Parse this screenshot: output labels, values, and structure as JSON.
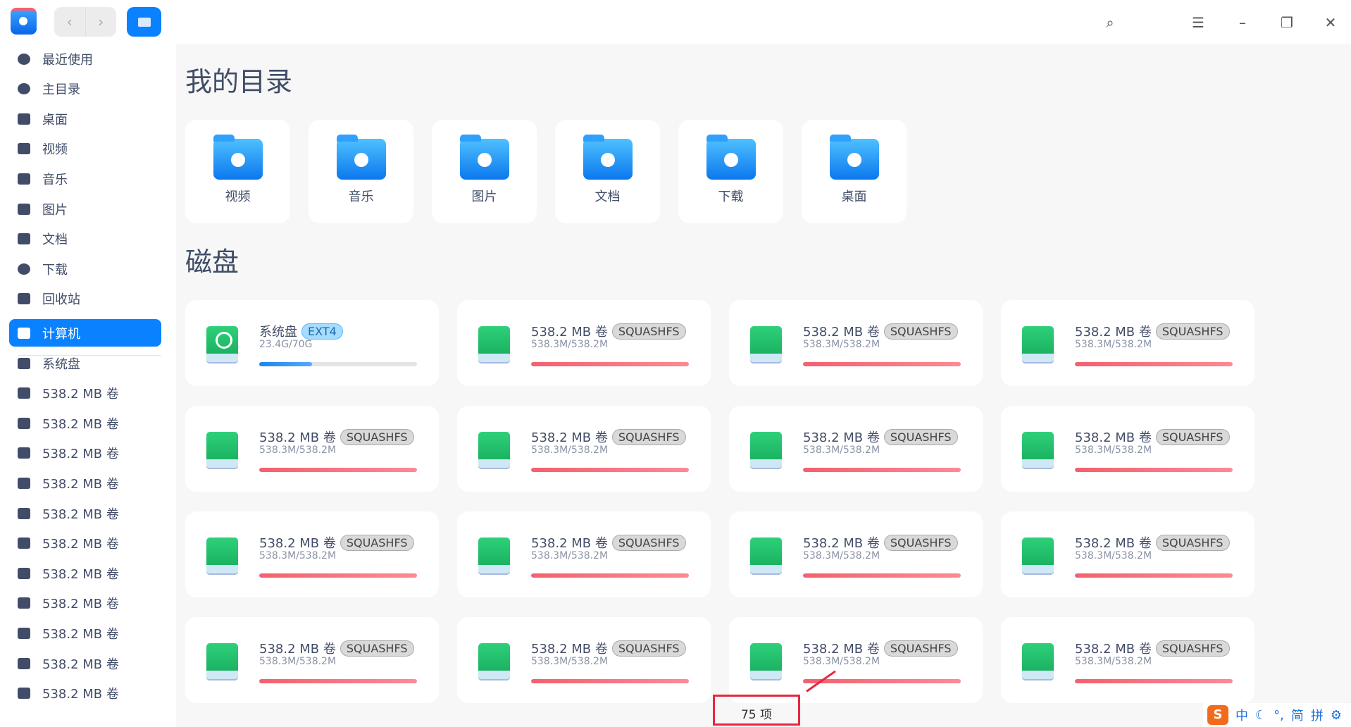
{
  "header": {
    "icons": [
      "app-logo",
      "back-icon",
      "forward-icon",
      "computer-view-icon",
      "search-icon",
      "menu-icon",
      "minimize-icon",
      "maximize-icon",
      "close-icon"
    ]
  },
  "sidebar": {
    "items": [
      {
        "label": "最近使用",
        "icon": "clock-icon"
      },
      {
        "label": "主目录",
        "icon": "home-icon"
      },
      {
        "label": "桌面",
        "icon": "desktop-icon"
      },
      {
        "label": "视频",
        "icon": "video-icon"
      },
      {
        "label": "音乐",
        "icon": "music-icon"
      },
      {
        "label": "图片",
        "icon": "picture-icon"
      },
      {
        "label": "文档",
        "icon": "document-icon"
      },
      {
        "label": "下载",
        "icon": "download-icon"
      },
      {
        "label": "回收站",
        "icon": "trash-icon"
      },
      {
        "label": "计算机",
        "icon": "computer-icon",
        "selected": true
      },
      {
        "label": "系统盘",
        "icon": "system-disk-icon"
      },
      {
        "label": "538.2 MB 卷",
        "icon": "disk-icon"
      },
      {
        "label": "538.2 MB 卷",
        "icon": "disk-icon"
      },
      {
        "label": "538.2 MB 卷",
        "icon": "disk-icon"
      },
      {
        "label": "538.2 MB 卷",
        "icon": "disk-icon"
      },
      {
        "label": "538.2 MB 卷",
        "icon": "disk-icon"
      },
      {
        "label": "538.2 MB 卷",
        "icon": "disk-icon"
      },
      {
        "label": "538.2 MB 卷",
        "icon": "disk-icon"
      },
      {
        "label": "538.2 MB 卷",
        "icon": "disk-icon"
      },
      {
        "label": "538.2 MB 卷",
        "icon": "disk-icon"
      },
      {
        "label": "538.2 MB 卷",
        "icon": "disk-icon"
      },
      {
        "label": "538.2 MB 卷",
        "icon": "disk-icon"
      }
    ]
  },
  "main": {
    "dirs_title": "我的目录",
    "folders": [
      {
        "label": "视频"
      },
      {
        "label": "音乐"
      },
      {
        "label": "图片"
      },
      {
        "label": "文档"
      },
      {
        "label": "下载"
      },
      {
        "label": "桌面"
      }
    ],
    "disks_title": "磁盘",
    "disks": [
      {
        "name": "系统盘",
        "fs": "EXT4",
        "usage": "23.4G/70G",
        "used": 0.334,
        "system": true
      },
      {
        "name": "538.2 MB 卷",
        "fs": "SQUASHFS",
        "usage": "538.3M/538.2M",
        "used": 1
      },
      {
        "name": "538.2 MB 卷",
        "fs": "SQUASHFS",
        "usage": "538.3M/538.2M",
        "used": 1
      },
      {
        "name": "538.2 MB 卷",
        "fs": "SQUASHFS",
        "usage": "538.3M/538.2M",
        "used": 1
      },
      {
        "name": "538.2 MB 卷",
        "fs": "SQUASHFS",
        "usage": "538.3M/538.2M",
        "used": 1
      },
      {
        "name": "538.2 MB 卷",
        "fs": "SQUASHFS",
        "usage": "538.3M/538.2M",
        "used": 1
      },
      {
        "name": "538.2 MB 卷",
        "fs": "SQUASHFS",
        "usage": "538.3M/538.2M",
        "used": 1
      },
      {
        "name": "538.2 MB 卷",
        "fs": "SQUASHFS",
        "usage": "538.3M/538.2M",
        "used": 1
      },
      {
        "name": "538.2 MB 卷",
        "fs": "SQUASHFS",
        "usage": "538.3M/538.2M",
        "used": 1
      },
      {
        "name": "538.2 MB 卷",
        "fs": "SQUASHFS",
        "usage": "538.3M/538.2M",
        "used": 1
      },
      {
        "name": "538.2 MB 卷",
        "fs": "SQUASHFS",
        "usage": "538.3M/538.2M",
        "used": 1
      },
      {
        "name": "538.2 MB 卷",
        "fs": "SQUASHFS",
        "usage": "538.3M/538.2M",
        "used": 1
      },
      {
        "name": "538.2 MB 卷",
        "fs": "SQUASHFS",
        "usage": "538.3M/538.2M",
        "used": 1
      },
      {
        "name": "538.2 MB 卷",
        "fs": "SQUASHFS",
        "usage": "538.3M/538.2M",
        "used": 1
      },
      {
        "name": "538.2 MB 卷",
        "fs": "SQUASHFS",
        "usage": "538.3M/538.2M",
        "used": 1
      },
      {
        "name": "538.2 MB 卷",
        "fs": "SQUASHFS",
        "usage": "538.3M/538.2M",
        "used": 1
      }
    ]
  },
  "status": {
    "count": "75 项"
  },
  "ime": {
    "items": [
      "中",
      "☾",
      "°,",
      "简",
      "拼",
      "⚙"
    ]
  },
  "colors": {
    "accent": "#0a81ff",
    "full_bar": "#f4606f",
    "normal_bar": "#1a84f0"
  }
}
